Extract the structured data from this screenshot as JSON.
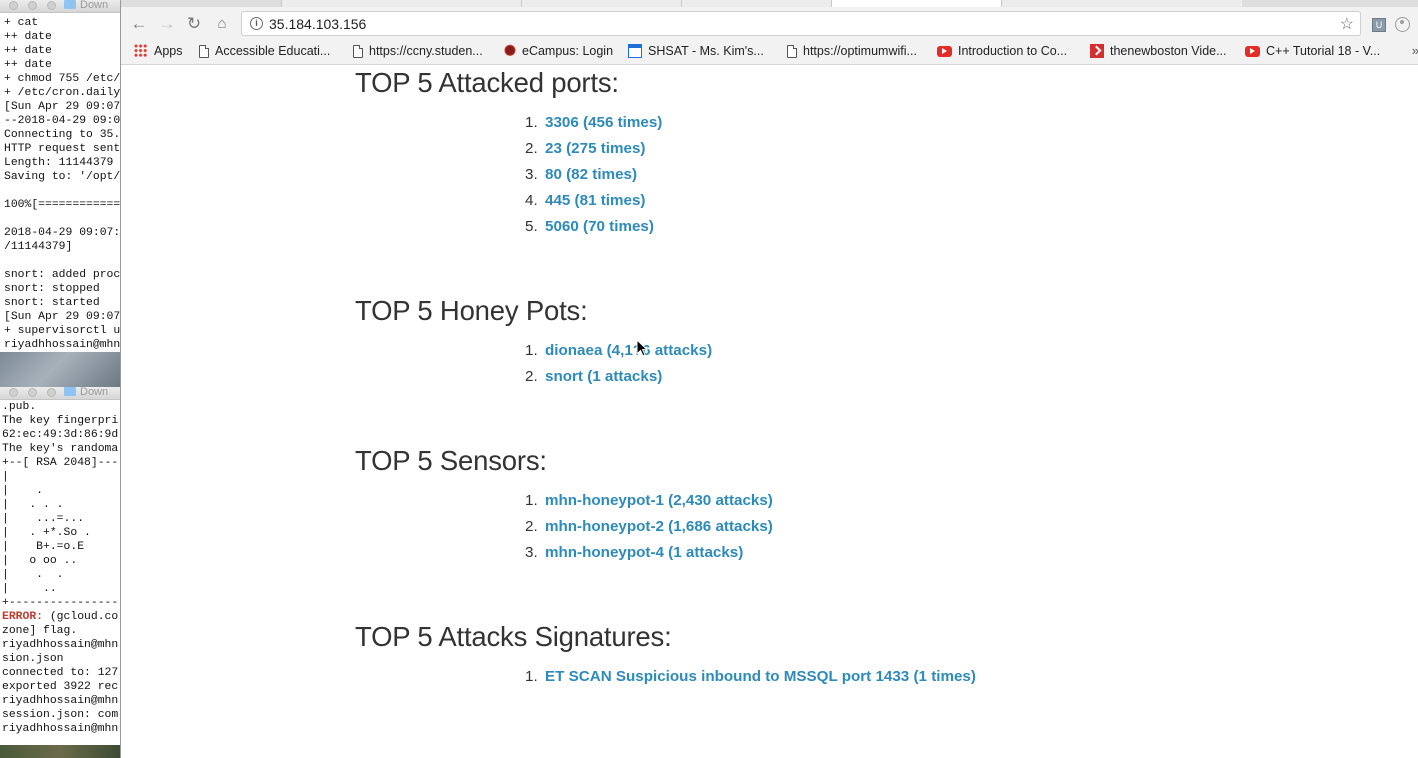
{
  "terminal_top": {
    "title": "Down",
    "lines": [
      "+ cat",
      "++ date",
      "++ date",
      "++ date",
      "+ chmod 755 /etc/",
      "+ /etc/cron.daily",
      "[Sun Apr 29 09:07",
      "--2018-04-29 09:0",
      "Connecting to 35.",
      "HTTP request sent",
      "Length: 11144379",
      "Saving to: '/opt/",
      "",
      "100%[============",
      "",
      "2018-04-29 09:07:",
      "/11144379]",
      "",
      "snort: added proc",
      "snort: stopped",
      "snort: started",
      "[Sun Apr 29 09:07",
      "+ supervisorctl u",
      "riyadhhossain@mhn"
    ]
  },
  "terminal_bottom": {
    "title": "Down",
    "lines_before_error": [
      ".pub.",
      "The key fingerpri",
      "62:ec:49:3d:86:9d",
      "The key's randoma",
      "+--[ RSA 2048]---",
      "|",
      "|    .",
      "|   . . .",
      "|    ...=...",
      "|   . +*.So .",
      "|    B+.=o.E",
      "|   o oo ..",
      "|    .  .",
      "|     ..",
      "+----------------"
    ],
    "error_label": "ERROR:",
    "error_rest": " (gcloud.co",
    "lines_after_error": [
      "zone] flag.",
      "riyadhhossain@mhn",
      "sion.json",
      "connected to: 127",
      "exported 3922 rec",
      "riyadhhossain@mhn",
      "session.json: com",
      "riyadhhossain@mhn"
    ]
  },
  "browser": {
    "url": "35.184.103.156",
    "bookmarks": [
      {
        "label": "Apps",
        "icon": "apps-grid-icon"
      },
      {
        "label": "Accessible Educati...",
        "icon": "page-icon"
      },
      {
        "label": "https://ccny.studen...",
        "icon": "page-icon"
      },
      {
        "label": "eCampus: Login",
        "icon": "ecampus-icon"
      },
      {
        "label": "SHSAT - Ms. Kim's...",
        "icon": "shsat-icon"
      },
      {
        "label": "https://optimumwifi...",
        "icon": "page-icon"
      },
      {
        "label": "Introduction to Co...",
        "icon": "youtube-icon"
      },
      {
        "label": "thenewboston Vide...",
        "icon": "thenewboston-icon"
      },
      {
        "label": "C++ Tutorial 18 - V...",
        "icon": "youtube-icon"
      }
    ],
    "bookmarks_overflow": "»"
  },
  "page": {
    "sections": [
      {
        "title": "TOP 5 Attacked ports:",
        "items": [
          "3306 (456 times)",
          "23 (275 times)",
          "80 (82 times)",
          "445 (81 times)",
          "5060 (70 times)"
        ]
      },
      {
        "title": "TOP 5 Honey Pots:",
        "items": [
          "dionaea (4,1?6 attacks)",
          "snort (1 attacks)"
        ]
      },
      {
        "title": "TOP 5 Sensors:",
        "items": [
          "mhn-honeypot-1 (2,430 attacks)",
          "mhn-honeypot-2 (1,686 attacks)",
          "mhn-honeypot-4 (1 attacks)"
        ]
      },
      {
        "title": "TOP 5 Attacks Signatures:",
        "items": [
          "ET SCAN Suspicious inbound to MSSQL port 1433 (1 times)"
        ]
      }
    ]
  },
  "colors": {
    "link": "#2e8ab8",
    "heading": "#333333"
  }
}
